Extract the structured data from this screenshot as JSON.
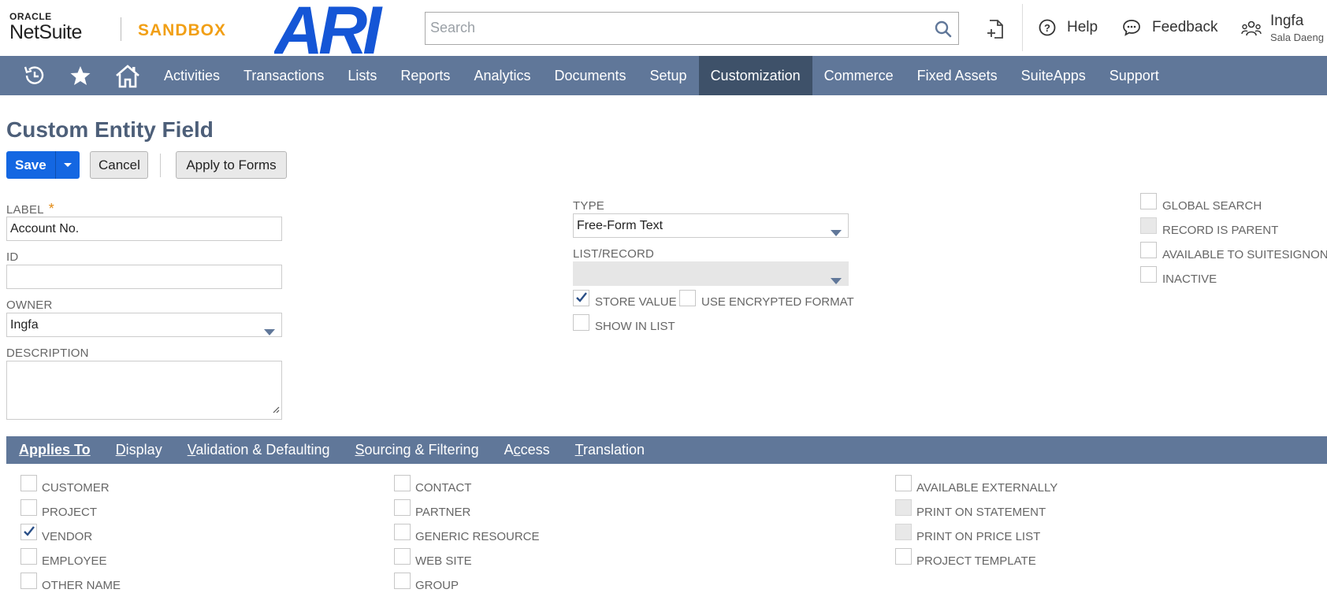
{
  "header": {
    "oracle_text": "ORACLE",
    "netsuite_text": "NetSuite",
    "sandbox_text": "SANDBOX",
    "company_logo_text": "ARI",
    "search_placeholder": "Search",
    "help_label": "Help",
    "feedback_label": "Feedback",
    "user_name": "Ingfa",
    "user_sub": "Sala Daeng"
  },
  "nav": {
    "items": [
      "Activities",
      "Transactions",
      "Lists",
      "Reports",
      "Analytics",
      "Documents",
      "Setup",
      "Customization",
      "Commerce",
      "Fixed Assets",
      "SuiteApps",
      "Support"
    ],
    "active": "Customization"
  },
  "page": {
    "title": "Custom Entity Field",
    "save_label": "Save",
    "cancel_label": "Cancel",
    "apply_label": "Apply to Forms"
  },
  "form": {
    "label_label": "LABEL",
    "label_required": "*",
    "label_value": "Account No.",
    "id_label": "ID",
    "id_value": "",
    "owner_label": "OWNER",
    "owner_value": "Ingfa",
    "description_label": "DESCRIPTION",
    "description_value": "",
    "type_label": "TYPE",
    "type_value": "Free-Form Text",
    "listrecord_label": "LIST/RECORD",
    "listrecord_value": "",
    "store_value_label": "STORE VALUE",
    "store_value_checked": true,
    "use_encrypted_label": "USE ENCRYPTED FORMAT",
    "use_encrypted_checked": false,
    "show_in_list_label": "SHOW IN LIST",
    "show_in_list_checked": false,
    "global_search_label": "GLOBAL SEARCH",
    "record_is_parent_label": "RECORD IS PARENT",
    "available_suitesignon_label": "AVAILABLE TO SUITESIGNON",
    "inactive_label": "INACTIVE"
  },
  "subtabs": {
    "items": [
      {
        "first": "A",
        "rest": "pplies To"
      },
      {
        "first": "D",
        "rest": "isplay"
      },
      {
        "first": "V",
        "rest": "alidation & Defaulting"
      },
      {
        "first": "S",
        "rest": "ourcing & Filtering"
      },
      {
        "first": "",
        "mid": "A",
        "pre": "A",
        "rest": "ccess"
      },
      {
        "first": "T",
        "rest": "ranslation"
      }
    ],
    "labels": [
      "Applies To",
      "Display",
      "Validation & Defaulting",
      "Sourcing & Filtering",
      "Access",
      "Translation"
    ]
  },
  "applies_to": {
    "col1": [
      {
        "label": "CUSTOMER",
        "checked": false
      },
      {
        "label": "PROJECT",
        "checked": false
      },
      {
        "label": "VENDOR",
        "checked": true
      },
      {
        "label": "EMPLOYEE",
        "checked": false
      },
      {
        "label": "OTHER NAME",
        "checked": false
      }
    ],
    "col2": [
      {
        "label": "CONTACT",
        "checked": false
      },
      {
        "label": "PARTNER",
        "checked": false
      },
      {
        "label": "GENERIC RESOURCE",
        "checked": false
      },
      {
        "label": "WEB SITE",
        "checked": false
      },
      {
        "label": "GROUP",
        "checked": false
      }
    ],
    "col3": [
      {
        "label": "AVAILABLE EXTERNALLY",
        "checked": false,
        "disabled": false
      },
      {
        "label": "PRINT ON STATEMENT",
        "checked": false,
        "disabled": true
      },
      {
        "label": "PRINT ON PRICE LIST",
        "checked": false,
        "disabled": true
      },
      {
        "label": "PROJECT TEMPLATE",
        "checked": false,
        "disabled": false
      }
    ]
  },
  "colors": {
    "nav_bg": "#607799",
    "nav_active": "#3e5169",
    "primary_button": "#1467e2",
    "sandbox_orange": "#f19f15",
    "ari_blue": "#1556d6",
    "title_color": "#4d5f79"
  }
}
